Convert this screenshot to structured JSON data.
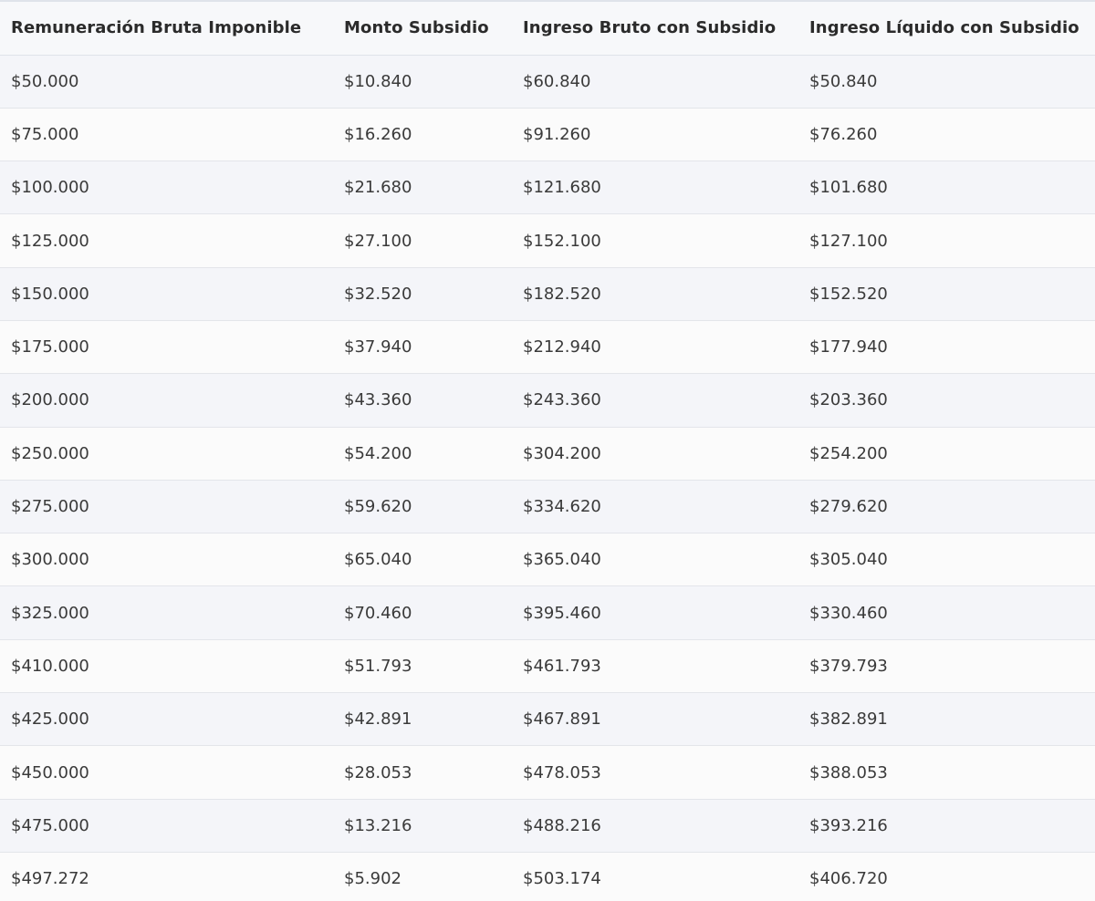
{
  "table": {
    "headers": [
      "Remuneración Bruta Imponible",
      "Monto Subsidio",
      "Ingreso Bruto con Subsidio",
      "Ingreso Líquido con Subsidio"
    ],
    "rows": [
      [
        "$50.000",
        "$10.840",
        "$60.840",
        "$50.840"
      ],
      [
        "$75.000",
        "$16.260",
        "$91.260",
        "$76.260"
      ],
      [
        "$100.000",
        "$21.680",
        "$121.680",
        "$101.680"
      ],
      [
        "$125.000",
        "$27.100",
        "$152.100",
        "$127.100"
      ],
      [
        "$150.000",
        "$32.520",
        "$182.520",
        "$152.520"
      ],
      [
        "$175.000",
        "$37.940",
        "$212.940",
        "$177.940"
      ],
      [
        "$200.000",
        "$43.360",
        "$243.360",
        "$203.360"
      ],
      [
        "$250.000",
        "$54.200",
        "$304.200",
        "$254.200"
      ],
      [
        "$275.000",
        "$59.620",
        "$334.620",
        "$279.620"
      ],
      [
        "$300.000",
        "$65.040",
        "$365.040",
        "$305.040"
      ],
      [
        "$325.000",
        "$70.460",
        "$395.460",
        "$330.460"
      ],
      [
        "$410.000",
        "$51.793",
        "$461.793",
        "$379.793"
      ],
      [
        "$425.000",
        "$42.891",
        "$467.891",
        "$382.891"
      ],
      [
        "$450.000",
        "$28.053",
        "$478.053",
        "$388.053"
      ],
      [
        "$475.000",
        "$13.216",
        "$488.216",
        "$393.216"
      ],
      [
        "$497.272",
        "$5.902",
        "$503.174",
        "$406.720"
      ]
    ]
  }
}
